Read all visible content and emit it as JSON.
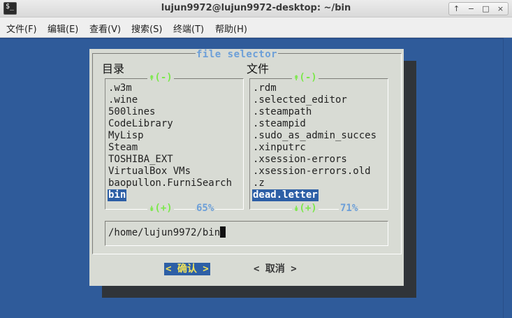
{
  "window": {
    "title": "lujun9972@lujun9972-desktop: ~/bin",
    "icon": "terminal-icon",
    "icon_glyph": "$_"
  },
  "controls": {
    "up": "↑",
    "min": "−",
    "max": "□",
    "close": "×"
  },
  "menu": [
    {
      "label": "文件(F)"
    },
    {
      "label": "编辑(E)"
    },
    {
      "label": "查看(V)"
    },
    {
      "label": "搜索(S)"
    },
    {
      "label": "终端(T)"
    },
    {
      "label": "帮助(H)"
    }
  ],
  "dialog": {
    "title": "file selector",
    "dirs": {
      "label": "目录",
      "scroll_up": "↟(-)",
      "scroll_down": "↡(+)",
      "percent": "65%",
      "items": [
        ".w3m",
        ".wine",
        "500lines",
        "CodeLibrary",
        "MyLisp",
        "Steam",
        "TOSHIBA_EXT",
        "VirtualBox VMs",
        "baopullon.FurniSearch",
        "bin"
      ],
      "selected_index": 9
    },
    "files": {
      "label": "文件",
      "scroll_up": "↟(-)",
      "scroll_down": "↡(+)",
      "percent": "71%",
      "items": [
        ".rdm",
        ".selected_editor",
        ".steampath",
        ".steampid",
        ".sudo_as_admin_succes",
        ".xinputrc",
        ".xsession-errors",
        ".xsession-errors.old",
        ".z",
        "dead.letter"
      ],
      "selected_index": 9
    },
    "path": "/home/lujun9972/bin",
    "ok_label": "< 确认 >",
    "cancel_label": "< 取消 >"
  },
  "colors": {
    "terminal_bg": "#2f5b9a",
    "dialog_bg": "#d8dbd4",
    "selection": "#2d5fa6",
    "accent_blue": "#6c9fd8",
    "arrow_green": "#7be84a",
    "ok_text": "#f1e35c"
  }
}
